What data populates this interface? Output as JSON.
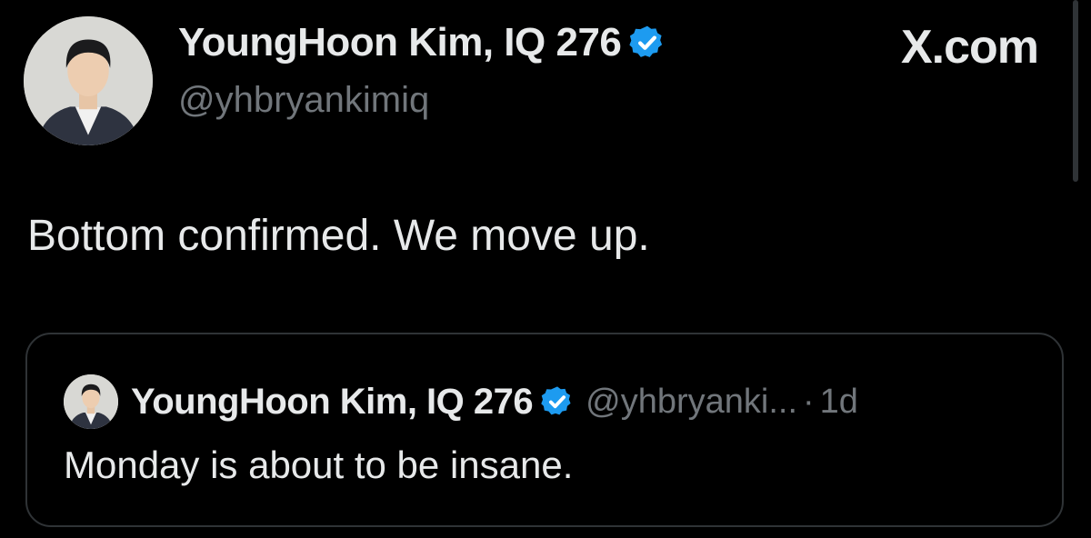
{
  "author": {
    "name": "YoungHoon Kim, IQ 276",
    "handle": "@yhbryankimiq",
    "verified": true
  },
  "brand": "X.com",
  "tweet": {
    "text": "Bottom confirmed. We move up."
  },
  "quoted_tweet": {
    "name": "YoungHoon Kim, IQ 276",
    "handle": "@yhbryanki...",
    "separator": "·",
    "time": "1d",
    "text": "Monday is about to be insane."
  },
  "colors": {
    "background": "#000000",
    "text": "#e7e9ea",
    "secondary": "#71767b",
    "verified": "#1d9bf0",
    "border": "#2f3336"
  },
  "icons": {
    "verified": "verified-badge-icon",
    "avatar": "profile-photo"
  }
}
